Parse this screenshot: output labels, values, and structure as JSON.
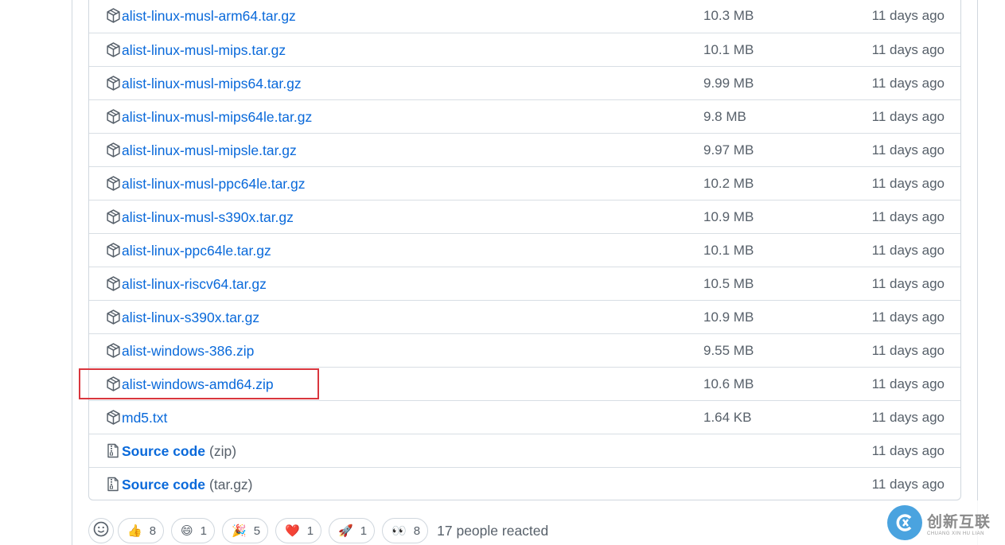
{
  "assets": [
    {
      "name": "alist-linux-musl-arm64.tar.gz",
      "size": "10.3 MB",
      "date": "11 days ago",
      "icon": "package-icon"
    },
    {
      "name": "alist-linux-musl-mips.tar.gz",
      "size": "10.1 MB",
      "date": "11 days ago",
      "icon": "package-icon"
    },
    {
      "name": "alist-linux-musl-mips64.tar.gz",
      "size": "9.99 MB",
      "date": "11 days ago",
      "icon": "package-icon"
    },
    {
      "name": "alist-linux-musl-mips64le.tar.gz",
      "size": "9.8 MB",
      "date": "11 days ago",
      "icon": "package-icon"
    },
    {
      "name": "alist-linux-musl-mipsle.tar.gz",
      "size": "9.97 MB",
      "date": "11 days ago",
      "icon": "package-icon"
    },
    {
      "name": "alist-linux-musl-ppc64le.tar.gz",
      "size": "10.2 MB",
      "date": "11 days ago",
      "icon": "package-icon"
    },
    {
      "name": "alist-linux-musl-s390x.tar.gz",
      "size": "10.9 MB",
      "date": "11 days ago",
      "icon": "package-icon"
    },
    {
      "name": "alist-linux-ppc64le.tar.gz",
      "size": "10.1 MB",
      "date": "11 days ago",
      "icon": "package-icon"
    },
    {
      "name": "alist-linux-riscv64.tar.gz",
      "size": "10.5 MB",
      "date": "11 days ago",
      "icon": "package-icon"
    },
    {
      "name": "alist-linux-s390x.tar.gz",
      "size": "10.9 MB",
      "date": "11 days ago",
      "icon": "package-icon"
    },
    {
      "name": "alist-windows-386.zip",
      "size": "9.55 MB",
      "date": "11 days ago",
      "icon": "package-icon"
    },
    {
      "name": "alist-windows-amd64.zip",
      "size": "10.6 MB",
      "date": "11 days ago",
      "icon": "package-icon",
      "highlighted": true
    },
    {
      "name": "md5.txt",
      "size": "1.64 KB",
      "date": "11 days ago",
      "icon": "package-icon"
    },
    {
      "name": "Source code",
      "suffix": "(zip)",
      "size": "",
      "date": "11 days ago",
      "icon": "file-zip-icon"
    },
    {
      "name": "Source code",
      "suffix": "(tar.gz)",
      "size": "",
      "date": "11 days ago",
      "icon": "file-zip-icon"
    }
  ],
  "reactions": {
    "add_icon": "smiley-icon",
    "items": [
      {
        "emoji": "👍",
        "icon": "thumbs-up-icon",
        "count": "8"
      },
      {
        "emoji": "😄",
        "icon": "laugh-icon",
        "count": "1"
      },
      {
        "emoji": "🎉",
        "icon": "hooray-icon",
        "count": "5"
      },
      {
        "emoji": "❤️",
        "icon": "heart-icon",
        "count": "1"
      },
      {
        "emoji": "🚀",
        "icon": "rocket-icon",
        "count": "1"
      },
      {
        "emoji": "👀",
        "icon": "eyes-icon",
        "count": "8"
      }
    ],
    "summary": "17 people reacted"
  },
  "watermark": {
    "text_cn": "创新互联",
    "text_en": "CHUANG XIN HU LIAN"
  },
  "colors": {
    "link": "#0969da",
    "muted": "#57606a",
    "border": "#d0d7de",
    "highlight": "#d9363e"
  }
}
